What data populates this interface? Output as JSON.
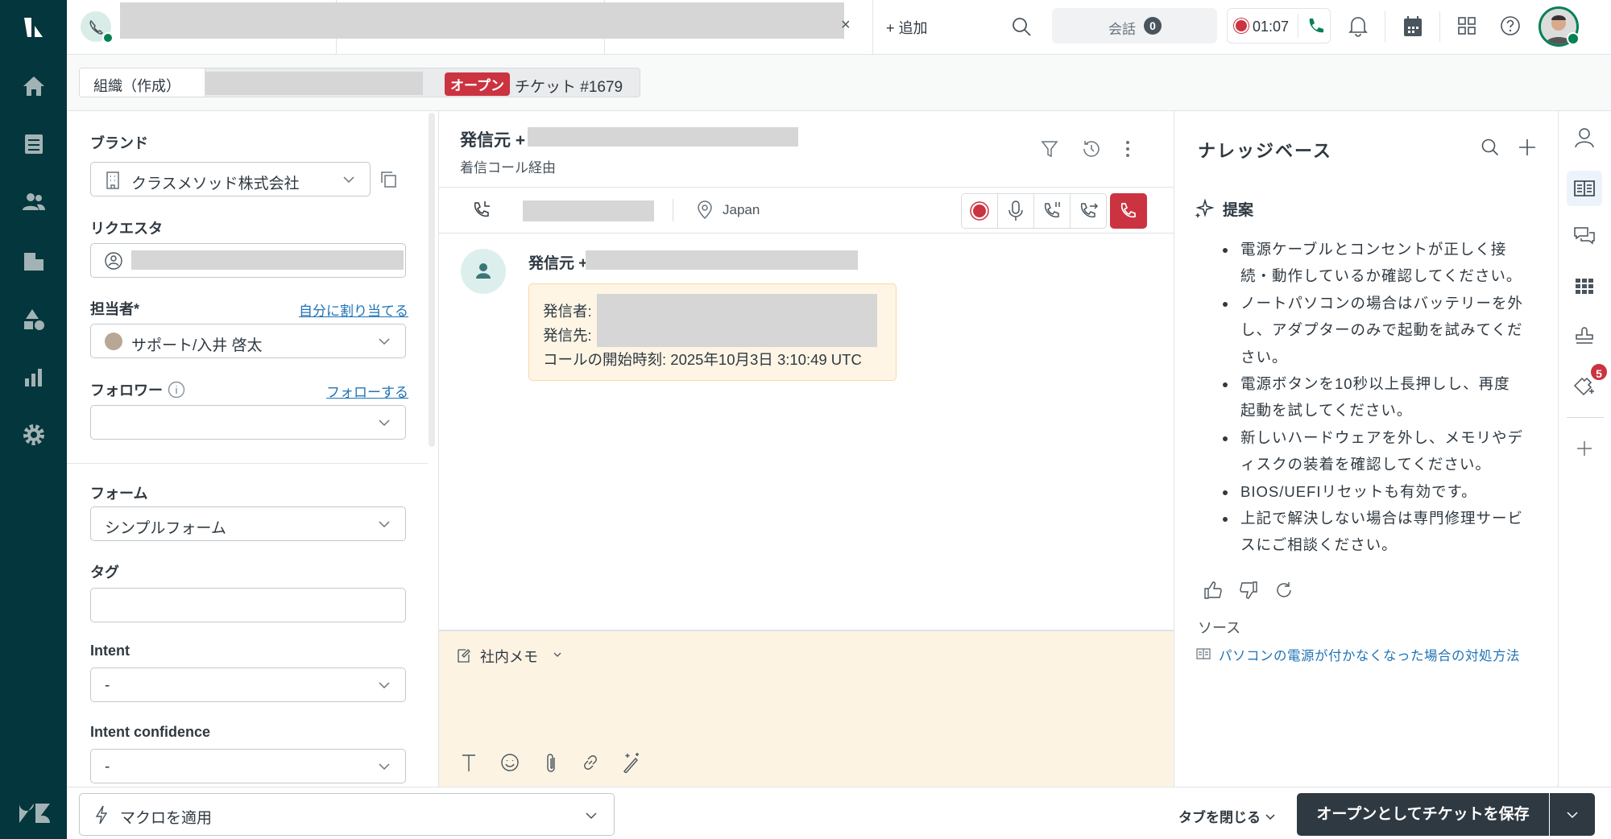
{
  "topbar": {
    "add_label": "+ 追加",
    "conversations_label": "会話",
    "conversations_count": "0",
    "call_timer": "01:07",
    "close_tab": "×"
  },
  "subheader": {
    "org_label": "組織（作成）",
    "status_badge": "オープン",
    "ticket_label": "チケット #1679",
    "status_color": "#cc3340"
  },
  "left": {
    "brand_label": "ブランド",
    "brand_value": "クラスメソッド株式会社",
    "requester_label": "リクエスタ",
    "assignee_label": "担当者*",
    "assign_self": "自分に割り当てる",
    "assignee_value": "サポート/入井 啓太",
    "followers_label": "フォロワー",
    "follow_link": "フォローする",
    "form_label": "フォーム",
    "form_value": "シンプルフォーム",
    "tags_label": "タグ",
    "intent_label": "Intent",
    "intent_value": "-",
    "intent_conf_label": "Intent confidence",
    "intent_conf_value": "-"
  },
  "center": {
    "title": "発信元 +",
    "subtitle": "着信コール経由",
    "location": "Japan",
    "message": {
      "sender": "発信元 +",
      "caller_label": "発信者:",
      "callee_label": "発信先:",
      "start_time": "コールの開始時刻: 2025年10月3日 3:10:49 UTC"
    },
    "composer": {
      "mode": "社内メモ"
    }
  },
  "knowledge": {
    "title": "ナレッジベース",
    "suggest_label": "提案",
    "items": [
      "電源ケーブルとコンセントが正しく接続・動作しているか確認してください。",
      "ノートパソコンの場合はバッテリーを外し、アダプターのみで起動を試みてください。",
      "電源ボタンを10秒以上長押しし、再度起動を試してください。",
      "新しいハードウェアを外し、メモリやディスクの装着を確認してください。",
      "BIOS/UEFIリセットも有効です。",
      "上記で解決しない場合は専門修理サービスにご相談ください。"
    ],
    "source_label": "ソース",
    "source_link": "パソコンの電源が付かなくなった場合の対処方法"
  },
  "rail": {
    "badge": "5"
  },
  "footer": {
    "macro_label": "マクロを適用",
    "close_tab_label": "タブを閉じる",
    "save_label": "オープンとしてチケットを保存"
  },
  "colors": {
    "nav": "#03363d",
    "accent": "#1f73b7",
    "danger": "#cc3340",
    "green": "#038153",
    "composer_bg": "#fdf3e3"
  }
}
